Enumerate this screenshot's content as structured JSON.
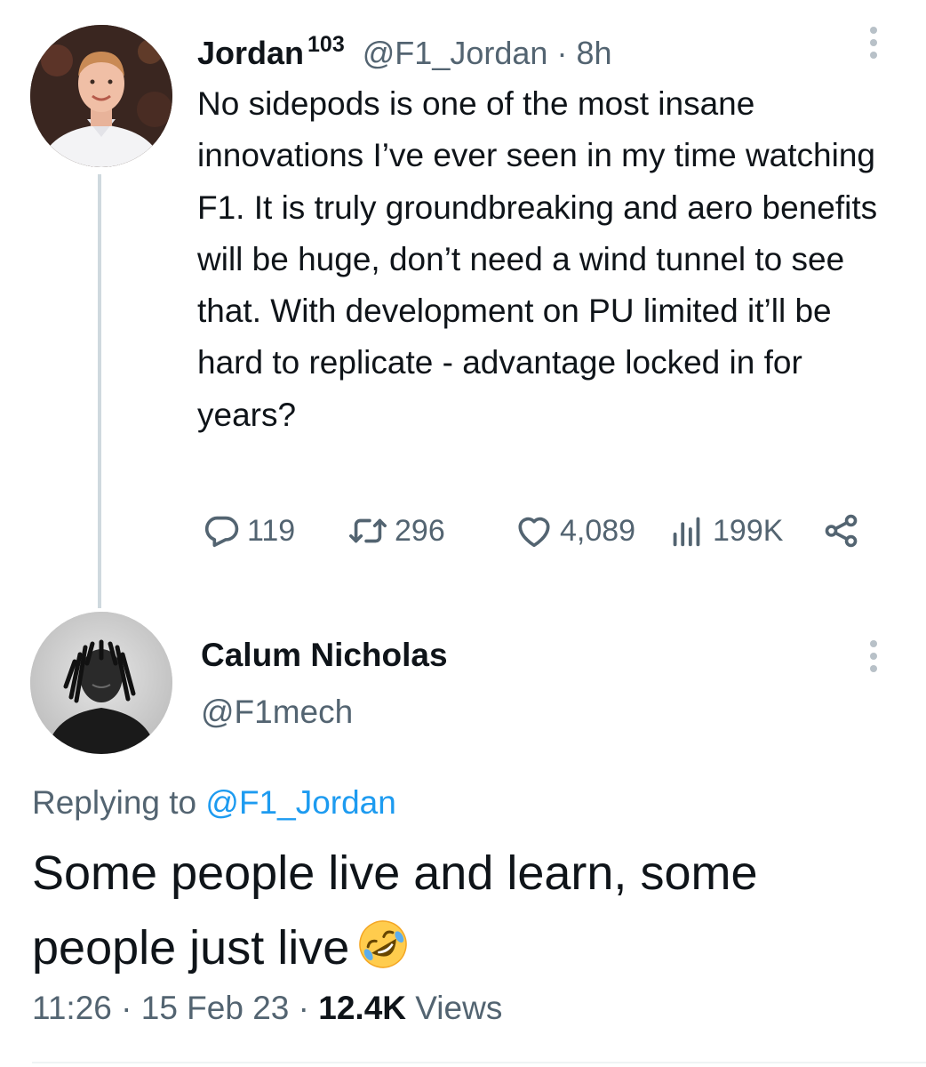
{
  "parent_tweet": {
    "display_name": "Jordan",
    "badge_number": "103",
    "handle": "@F1_Jordan",
    "separator": "·",
    "age": "8h",
    "text": "No sidepods is one of the most insane innovations I’ve ever seen in my time watching F1. It is truly groundbreaking and aero benefits will be huge, don’t need a wind tunnel to see that. With development on PU limited it’ll be hard to replicate - advantage locked in for years?",
    "replies": "119",
    "retweets": "296",
    "likes": "4,089",
    "views": "199K"
  },
  "reply_tweet": {
    "display_name": "Calum Nicholas",
    "handle": "@F1mech",
    "replying_prefix": "Replying to",
    "replying_to": "@F1_Jordan",
    "text": "Some people live and learn, some people just live",
    "emoji_name": "rolling-on-the-floor-laughing-emoji",
    "time": "11:26",
    "date": "15 Feb 23",
    "separator": "·",
    "views_count": "12.4K",
    "views_label": "Views"
  },
  "colors": {
    "text": "#0f1419",
    "secondary": "#536471",
    "link": "#1d9bf0",
    "thread_line": "#cfd9de"
  },
  "icons": [
    "reply-icon",
    "retweet-icon",
    "like-icon",
    "views-icon",
    "share-icon",
    "more-icon"
  ]
}
